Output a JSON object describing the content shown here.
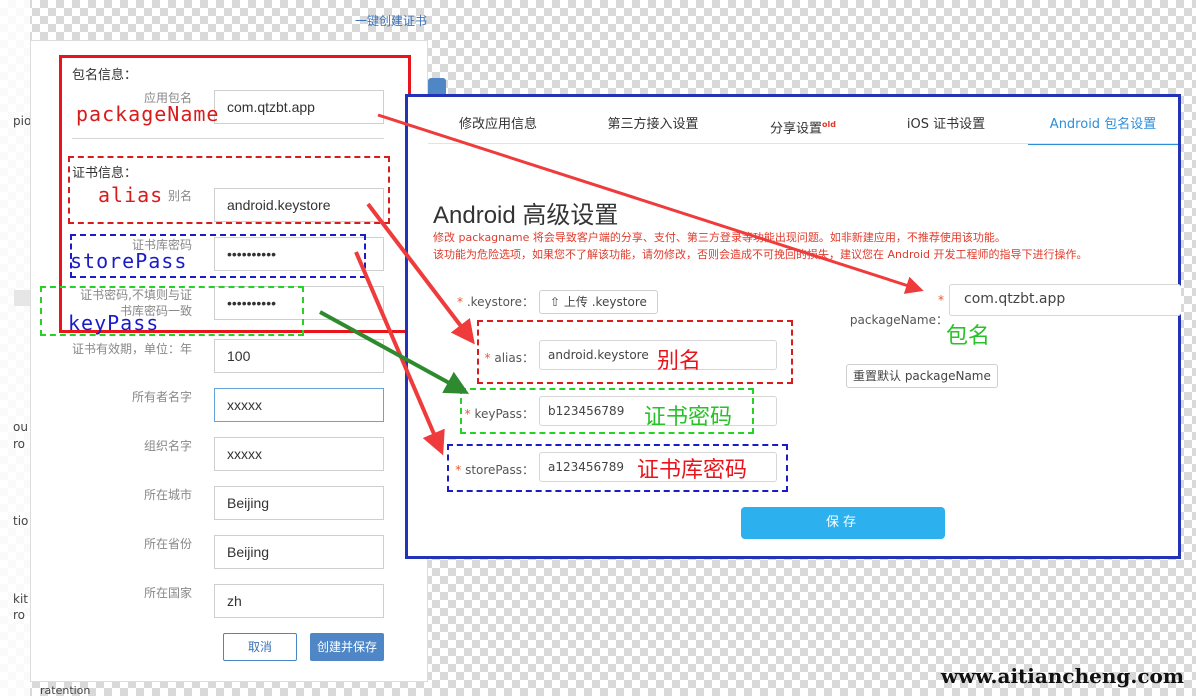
{
  "top_link": "一键创建证书",
  "bg_fragments": [
    "pio",
    "ou",
    "ro",
    "tio",
    "kit",
    "ro",
    "ratention"
  ],
  "left_form": {
    "package_section": "包名信息：",
    "app_package_label": "应用包名",
    "app_package_value": "com.qtzbt.app",
    "cert_section": "证书信息：",
    "alias_label": "别名",
    "alias_value": "android.keystore",
    "store_pass_label": "证书库密码",
    "store_pass_value": "••••••••••",
    "key_pass_label_1": "证书密码,不填则与证",
    "key_pass_label_2": "书库密码一致",
    "key_pass_value": "••••••••••",
    "validity_label": "证书有效期，单位：年",
    "validity_value": "100",
    "owner_label": "所有者名字",
    "owner_value": "xxxxx",
    "org_label": "组织名字",
    "org_value": "xxxxx",
    "city_label": "所在城市",
    "city_value": "Beijing",
    "province_label": "所在省份",
    "province_value": "Beijing",
    "country_label": "所在国家",
    "country_value": "zh",
    "cancel_label": "取消",
    "create_save_label": "创建并保存"
  },
  "left_annotations": {
    "packageName": "packageName",
    "alias": "alias",
    "storePass": "storePass",
    "keyPass": "keyPass"
  },
  "right_panel": {
    "tabs": [
      {
        "label": "修改应用信息"
      },
      {
        "label": "第三方接入设置"
      },
      {
        "label": "分享设置",
        "badge": "old"
      },
      {
        "label": "iOS 证书设置"
      },
      {
        "label": "Android 包名设置"
      }
    ],
    "title": "Android 高级设置",
    "warning_1": "修改 packagname 将会导致客户端的分享、支付、第三方登录等功能出现问题。如非新建应用，不推荐使用该功能。",
    "warning_2": "该功能为危险选项，如果您不了解该功能，请勿修改，否则会造成不可挽回的损失，建议您在 Android 开发工程师的指导下进行操作。",
    "keystore_label": ".keystore：",
    "upload_label": "上传 .keystore",
    "alias_label": "alias：",
    "alias_value": "android.keystore",
    "keypass_label": "keyPass：",
    "keypass_value": "b123456789",
    "storepass_label": "storePass：",
    "storepass_value": "a123456789",
    "package_label": "packageName：",
    "package_value": "com.qtzbt.app",
    "reset_label": "重置默认 packageName",
    "save_label": "保存",
    "star": "*"
  },
  "right_annotations": {
    "alias": "别名",
    "keypass": "证书密码",
    "storepass": "证书库密码",
    "package": "包名"
  },
  "watermark": "www.aitiancheng.com",
  "colors": {
    "annotation_red": "#e8161c",
    "annotation_blue": "#1b1bc8",
    "annotation_green": "#27d227",
    "active_tab": "#2d8ed8",
    "save_button": "#2cb0ee"
  }
}
